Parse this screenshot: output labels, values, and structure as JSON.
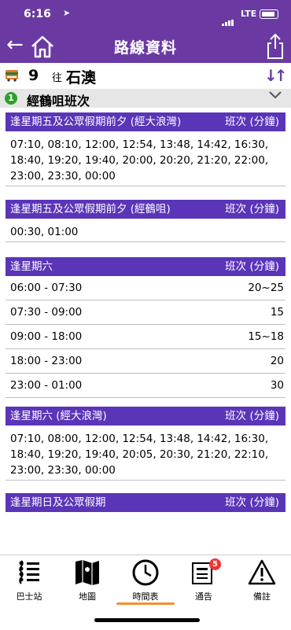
{
  "status_bar": {
    "time": "6:16",
    "carrier": "LTE"
  },
  "header": {
    "title": "路線資料"
  },
  "route": {
    "number": "9",
    "direction_prefix": "往",
    "destination": "石澳"
  },
  "via": {
    "index": "1",
    "label": "經鶴咀班次"
  },
  "sections": [
    {
      "title": "逢星期五及公眾假期前夕 (經大浪灣)",
      "freq_label": "班次 (分鐘)",
      "times": [
        "07:10, 08:10, 12:00, 12:54, 13:48, 14:42, 16:30,",
        "18:40, 19:20, 19:40, 20:00, 20:20, 21:20, 22:00,",
        "23:00, 23:30, 00:00"
      ]
    },
    {
      "title": "逢星期五及公眾假期前夕 (經鶴咀)",
      "freq_label": "班次 (分鐘)",
      "times": [
        "00:30, 01:00"
      ]
    },
    {
      "title": "逢星期六",
      "freq_label": "班次 (分鐘)",
      "rows": [
        {
          "period": "06:00 - 07:30",
          "freq": "20~25"
        },
        {
          "period": "07:30 - 09:00",
          "freq": "15"
        },
        {
          "period": "09:00 - 18:00",
          "freq": "15~18"
        },
        {
          "period": "18:00 - 23:00",
          "freq": "20"
        },
        {
          "period": "23:00 - 01:00",
          "freq": "30"
        }
      ]
    },
    {
      "title": "逢星期六 (經大浪灣)",
      "freq_label": "班次 (分鐘)",
      "times": [
        "07:10, 08:00, 12:00, 12:54, 13:48, 14:42, 16:30,",
        "18:40, 19:20, 19:40, 20:05, 20:30, 21:20, 22:10,",
        "23:00, 23:30, 00:00"
      ]
    },
    {
      "title": "逢星期日及公眾假期",
      "freq_label": "班次 (分鐘)"
    }
  ],
  "tabs": [
    {
      "label": "巴士站",
      "icon": "bus-stops-icon"
    },
    {
      "label": "地圖",
      "icon": "map-icon"
    },
    {
      "label": "時間表",
      "icon": "clock-icon",
      "active": true
    },
    {
      "label": "通告",
      "icon": "notice-icon",
      "badge": "5"
    },
    {
      "label": "備註",
      "icon": "warning-icon"
    }
  ],
  "colors": {
    "primary": "#6a3aa2",
    "section_header": "#5a35b8",
    "active_tab": "#f39030"
  }
}
